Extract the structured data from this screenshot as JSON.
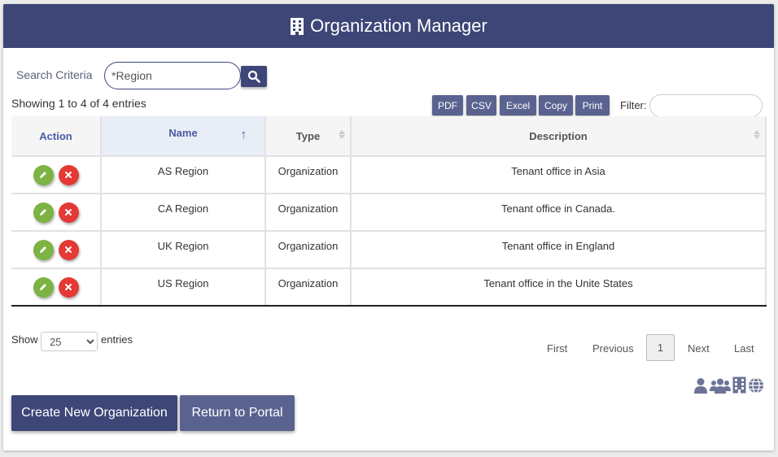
{
  "header": {
    "title": "Organization Manager",
    "icon": "building-icon"
  },
  "search": {
    "label": "Search Criteria",
    "value": "*Region",
    "button_icon": "search-icon"
  },
  "info": {
    "showing": "Showing 1 to 4 of 4 entries"
  },
  "export_buttons": [
    "PDF",
    "CSV",
    "Excel",
    "Copy",
    "Print"
  ],
  "filter": {
    "label": "Filter:",
    "value": ""
  },
  "table": {
    "columns": [
      "Action",
      "Name",
      "Type",
      "Description"
    ],
    "sorted_column": "Name",
    "sort_direction": "ascending",
    "rows": [
      {
        "name": "AS Region",
        "type": "Organization",
        "description": "Tenant office in Asia"
      },
      {
        "name": "CA Region",
        "type": "Organization",
        "description": "Tenant office in Canada."
      },
      {
        "name": "UK Region",
        "type": "Organization",
        "description": "Tenant office in England"
      },
      {
        "name": "US Region",
        "type": "Organization",
        "description": "Tenant office in the Unite States"
      }
    ]
  },
  "length": {
    "show_label": "Show",
    "value": "25",
    "entries_label": "entries"
  },
  "pagination": {
    "first": "First",
    "previous": "Previous",
    "current": "1",
    "next": "Next",
    "last": "Last"
  },
  "footer_icons": [
    "user-icon",
    "users-icon",
    "building-icon",
    "globe-icon"
  ],
  "buttons": {
    "create": "Create New Organization",
    "return": "Return to Portal"
  },
  "colors": {
    "primary": "#3d4677",
    "secondary": "#5a6390",
    "edit": "#7cb342",
    "delete": "#e53935"
  }
}
